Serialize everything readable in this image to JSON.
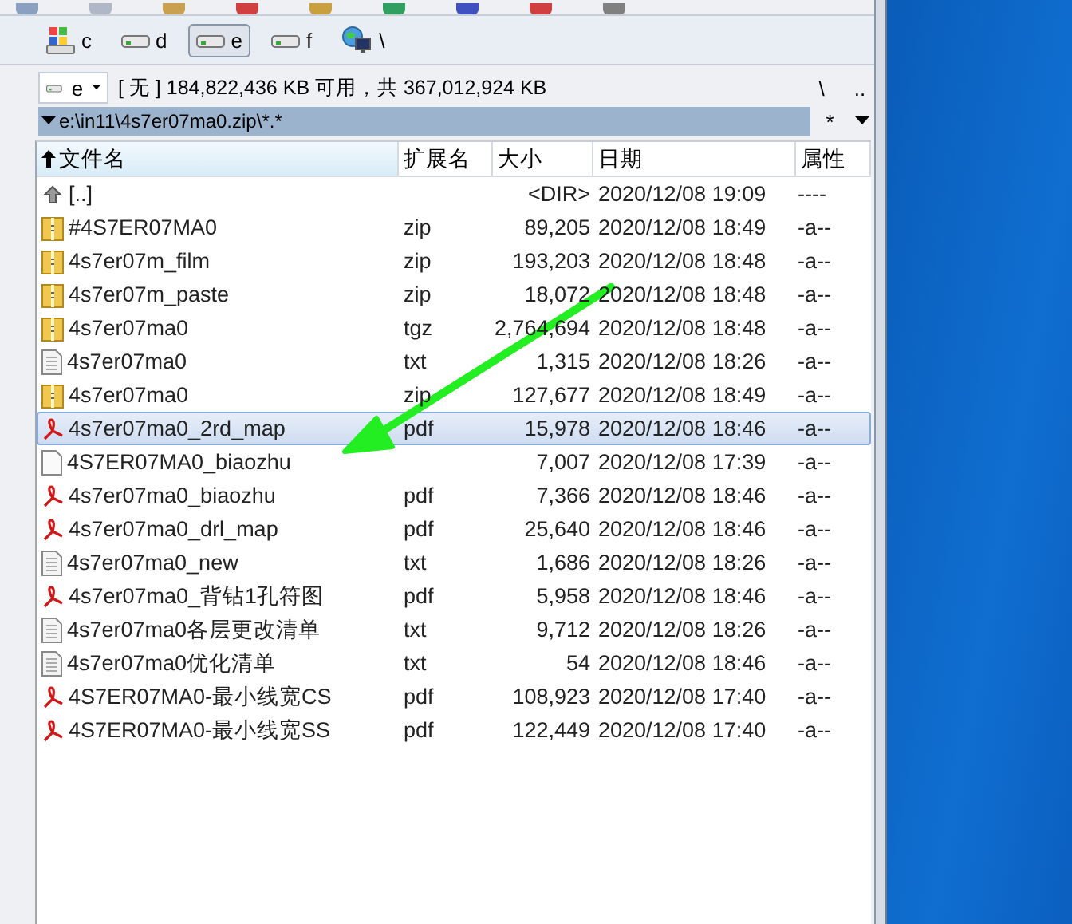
{
  "drives": [
    {
      "label": "c",
      "kind": "system",
      "selected": false
    },
    {
      "label": "d",
      "kind": "disk",
      "selected": false
    },
    {
      "label": "e",
      "kind": "disk",
      "selected": true
    },
    {
      "label": "f",
      "kind": "disk",
      "selected": false
    },
    {
      "label": "\\",
      "kind": "network",
      "selected": false
    }
  ],
  "drive_select": {
    "value": "e"
  },
  "disk_info": "[ 无 ] 184,822,436 KB 可用，共 367,012,924 KB",
  "nav_buttons": [
    "\\",
    ".."
  ],
  "path": "e:\\in11\\4s7er07ma0.zip\\*.*",
  "filter_button": "*",
  "columns": [
    {
      "label": "文件名",
      "sorted": true
    },
    {
      "label": "扩展名",
      "sorted": false
    },
    {
      "label": "大小",
      "sorted": false
    },
    {
      "label": "日期",
      "sorted": false
    },
    {
      "label": "属性",
      "sorted": false
    }
  ],
  "rows": [
    {
      "kind": "up",
      "name": "[..]",
      "ext": "",
      "size": "<DIR>",
      "date": "2020/12/08 19:09",
      "attr": "----",
      "selected": false
    },
    {
      "kind": "archive",
      "name": "#4S7ER07MA0",
      "ext": "zip",
      "size": "89,205",
      "date": "2020/12/08 18:49",
      "attr": "-a--",
      "selected": false
    },
    {
      "kind": "archive",
      "name": "4s7er07m_film",
      "ext": "zip",
      "size": "193,203",
      "date": "2020/12/08 18:48",
      "attr": "-a--",
      "selected": false
    },
    {
      "kind": "archive",
      "name": "4s7er07m_paste",
      "ext": "zip",
      "size": "18,072",
      "date": "2020/12/08 18:48",
      "attr": "-a--",
      "selected": false
    },
    {
      "kind": "archive",
      "name": "4s7er07ma0",
      "ext": "tgz",
      "size": "2,764,694",
      "date": "2020/12/08 18:48",
      "attr": "-a--",
      "selected": false
    },
    {
      "kind": "text",
      "name": "4s7er07ma0",
      "ext": "txt",
      "size": "1,315",
      "date": "2020/12/08 18:26",
      "attr": "-a--",
      "selected": false
    },
    {
      "kind": "archive",
      "name": "4s7er07ma0",
      "ext": "zip",
      "size": "127,677",
      "date": "2020/12/08 18:49",
      "attr": "-a--",
      "selected": false
    },
    {
      "kind": "pdf",
      "name": "4s7er07ma0_2rd_map",
      "ext": "pdf",
      "size": "15,978",
      "date": "2020/12/08 18:46",
      "attr": "-a--",
      "selected": true
    },
    {
      "kind": "blank",
      "name": "4S7ER07MA0_biaozhu",
      "ext": "",
      "size": "7,007",
      "date": "2020/12/08 17:39",
      "attr": "-a--",
      "selected": false
    },
    {
      "kind": "pdf",
      "name": "4s7er07ma0_biaozhu",
      "ext": "pdf",
      "size": "7,366",
      "date": "2020/12/08 18:46",
      "attr": "-a--",
      "selected": false
    },
    {
      "kind": "pdf",
      "name": "4s7er07ma0_drl_map",
      "ext": "pdf",
      "size": "25,640",
      "date": "2020/12/08 18:46",
      "attr": "-a--",
      "selected": false
    },
    {
      "kind": "text",
      "name": "4s7er07ma0_new",
      "ext": "txt",
      "size": "1,686",
      "date": "2020/12/08 18:26",
      "attr": "-a--",
      "selected": false
    },
    {
      "kind": "pdf",
      "name": "4s7er07ma0_背钻1孔符图",
      "ext": "pdf",
      "size": "5,958",
      "date": "2020/12/08 18:46",
      "attr": "-a--",
      "selected": false
    },
    {
      "kind": "text",
      "name": "4s7er07ma0各层更改清单",
      "ext": "txt",
      "size": "9,712",
      "date": "2020/12/08 18:26",
      "attr": "-a--",
      "selected": false
    },
    {
      "kind": "text",
      "name": "4s7er07ma0优化清单",
      "ext": "txt",
      "size": "54",
      "date": "2020/12/08 18:46",
      "attr": "-a--",
      "selected": false
    },
    {
      "kind": "pdf",
      "name": "4S7ER07MA0-最小线宽CS",
      "ext": "pdf",
      "size": "108,923",
      "date": "2020/12/08 17:40",
      "attr": "-a--",
      "selected": false
    },
    {
      "kind": "pdf",
      "name": "4S7ER07MA0-最小线宽SS",
      "ext": "pdf",
      "size": "122,449",
      "date": "2020/12/08 17:40",
      "attr": "-a--",
      "selected": false
    }
  ]
}
